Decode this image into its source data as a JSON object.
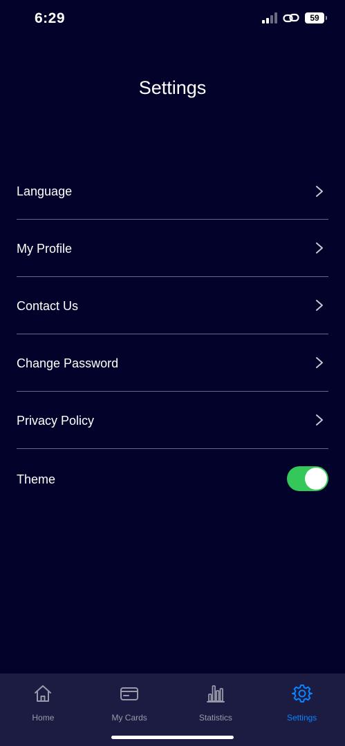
{
  "status_bar": {
    "time": "6:29",
    "battery": "59"
  },
  "header": {
    "title": "Settings"
  },
  "menu": {
    "items": [
      {
        "label": "Language"
      },
      {
        "label": "My Profile"
      },
      {
        "label": "Contact Us"
      },
      {
        "label": "Change Password"
      },
      {
        "label": "Privacy Policy"
      }
    ],
    "theme": {
      "label": "Theme",
      "enabled": true
    }
  },
  "tab_bar": {
    "tabs": [
      {
        "label": "Home",
        "icon": "home-icon"
      },
      {
        "label": "My Cards",
        "icon": "card-icon"
      },
      {
        "label": "Statistics",
        "icon": "bar-chart-icon"
      },
      {
        "label": "Settings",
        "icon": "gear-icon"
      }
    ],
    "active": "Settings"
  },
  "colors": {
    "background": "#02022a",
    "tab_bar_background": "#1c1c42",
    "toggle_on": "#34c759",
    "active_tab": "#0a84ff",
    "inactive_tab": "#9a9aaa",
    "divider": "#6a6a86"
  }
}
